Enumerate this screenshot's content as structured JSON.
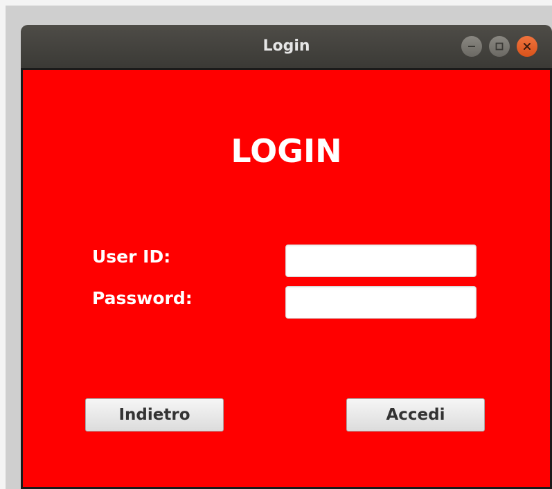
{
  "window": {
    "title": "Login"
  },
  "form": {
    "heading": "LOGIN",
    "user_label": "User ID:",
    "password_label": "Password:",
    "user_value": "",
    "password_value": "",
    "back_label": "Indietro",
    "login_label": "Accedi"
  },
  "colors": {
    "background": "#ff0000",
    "titlebar": "#3f3e3a",
    "close_button": "#e95420"
  },
  "icons": {
    "minimize": "minimize-icon",
    "maximize": "maximize-icon",
    "close": "close-icon"
  }
}
